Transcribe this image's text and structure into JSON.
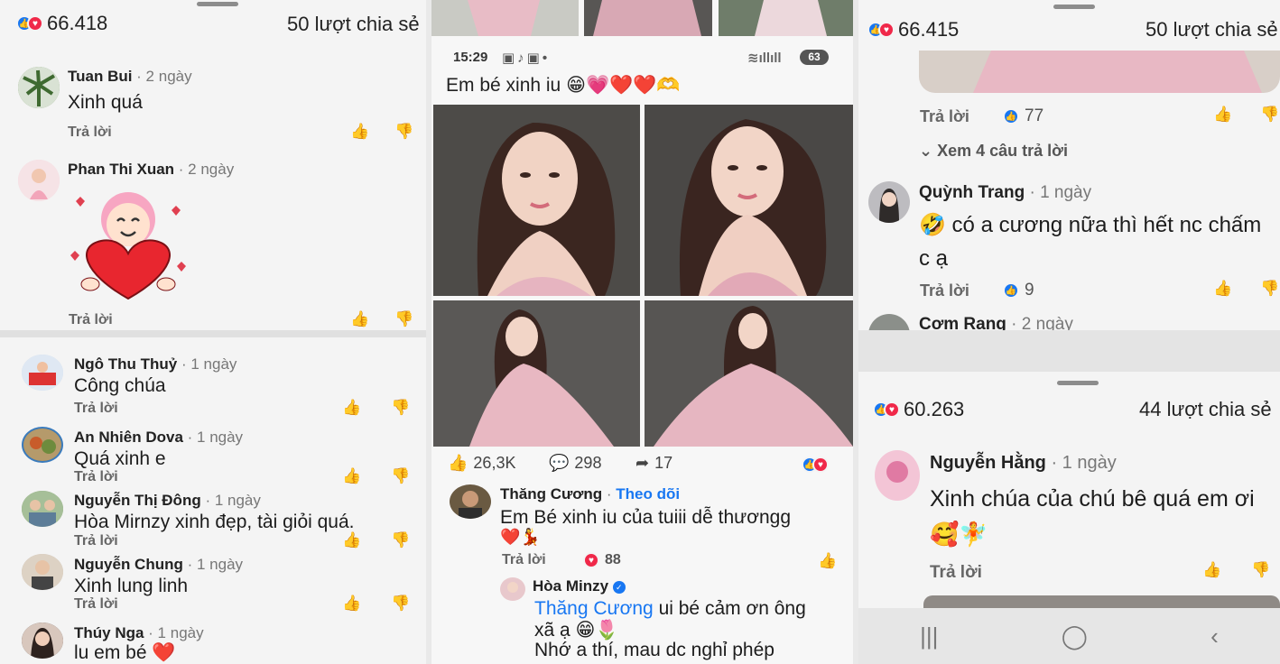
{
  "left": {
    "reactions": "66.418",
    "shares": "50 lượt chia sẻ",
    "reply_label": "Trả lời",
    "top_comments": [
      {
        "name": "Tuan Bui",
        "ago": " · 2 ngày",
        "text": "Xinh quá"
      },
      {
        "name": "Phan Thi Xuan",
        "ago": " · 2 ngày",
        "text": ""
      }
    ],
    "bottom_comments": [
      {
        "name": "Ngô Thu Thuỷ",
        "ago": " · 1 ngày",
        "text": "Công chúa"
      },
      {
        "name": "An Nhiên Dova",
        "ago": " · 1 ngày",
        "text": "Quá xinh e"
      },
      {
        "name": "Nguyễn Thị Đông",
        "ago": " · 1 ngày",
        "text": "Hòa Mirnzy xinh đẹp, tài giỏi quá."
      },
      {
        "name": "Nguyễn Chung",
        "ago": " · 1 ngày",
        "text": "Xinh lung linh"
      },
      {
        "name": "Thúy Nga",
        "ago": " · 1 ngày",
        "text": "lu em bé ❤️"
      }
    ]
  },
  "middle": {
    "time": "15:29",
    "battery": "63",
    "post_title": "Em bé xinh iu 😁💗❤️❤️🫶",
    "likes": "26,3K",
    "comments": "298",
    "shares": "17",
    "comment1": {
      "name": "Thăng Cương",
      "follow": "Theo dõi",
      "text": "Em Bé xinh iu của tuiii dễ thươngg",
      "emoji": "❤️💃",
      "reply": "Trả lời",
      "reactions": "88"
    },
    "comment2": {
      "name": "Hòa Minzy",
      "mention": "Thăng Cương",
      "text": " ui bé cảm ơn ông",
      "line2": "xã ạ 😁🌷",
      "line3": "Nhớ a thí, mau dc nghỉ phép"
    }
  },
  "right": {
    "reactions_top": "66.415",
    "shares_top": "50 lượt chia sẻ",
    "reply_label": "Trả lời",
    "likes_a": "77",
    "view_replies": "Xem 4 câu trả lời",
    "comment_trang": {
      "name": "Quỳnh Trang",
      "ago": " · 1 ngày",
      "line1": "🤣 có a cương nữa thì hết nc chấm",
      "line2": "c ạ",
      "likes": "9"
    },
    "comment_rang": {
      "name": "Cơm Rang",
      "ago": " · 2 ngày"
    },
    "reactions_bottom": "60.263",
    "shares_bottom": "44 lượt chia sẻ",
    "comment_hang": {
      "name": "Nguyễn Hằng",
      "ago": " · 1 ngày",
      "text": "Xinh chúa của chú bê quá em ơi",
      "emoji": "🥰🧚"
    }
  },
  "colors": {
    "like_blue": "#1877f2",
    "love_red": "#f02849",
    "dress_pink": "#e8b8c2"
  }
}
